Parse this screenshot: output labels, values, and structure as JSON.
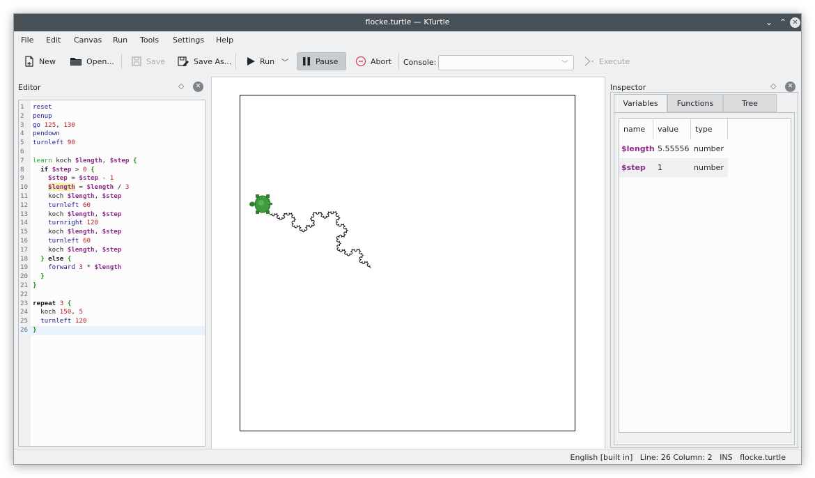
{
  "window": {
    "title": "flocke.turtle — KTurtle"
  },
  "menu": [
    "File",
    "Edit",
    "Canvas",
    "Run",
    "Tools",
    "Settings",
    "Help"
  ],
  "toolbar": {
    "new": "New",
    "open": "Open...",
    "save": "Save",
    "save_as": "Save As...",
    "run": "Run",
    "pause": "Pause",
    "abort": "Abort",
    "console_label": "Console:",
    "console_value": "",
    "execute": "Execute"
  },
  "editor": {
    "title": "Editor",
    "current_line": 26,
    "highlighted_word": "$length"
  },
  "inspector": {
    "title": "Inspector",
    "tabs": [
      "Variables",
      "Functions",
      "Tree"
    ],
    "active_tab": "Variables",
    "columns": [
      "name",
      "value",
      "type"
    ],
    "rows": [
      {
        "name": "$length",
        "value": "5.55556",
        "type": "number"
      },
      {
        "name": "$step",
        "value": "1",
        "type": "number"
      }
    ]
  },
  "status": {
    "text": "English [built in]   Line: 26 Column: 2   INS   flocke.turtle"
  },
  "colors": {
    "titlebar": "#475057",
    "turtle": "#3d9a3d",
    "window_bg": "#eff0f1"
  }
}
